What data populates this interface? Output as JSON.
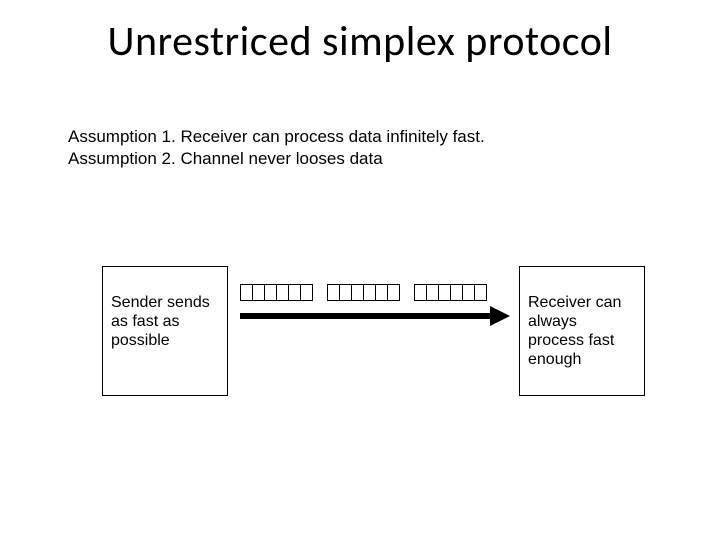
{
  "title": "Unrestriced simplex protocol",
  "assumptions": {
    "a1": "Assumption 1. Receiver can process data infinitely fast.",
    "a2": "Assumption 2. Channel never looses data"
  },
  "sender": {
    "label": "Sender sends as fast as possible"
  },
  "receiver": {
    "label": "Receiver can always process fast enough"
  },
  "packets": {
    "groups": 3,
    "cells_per_group": 6
  }
}
